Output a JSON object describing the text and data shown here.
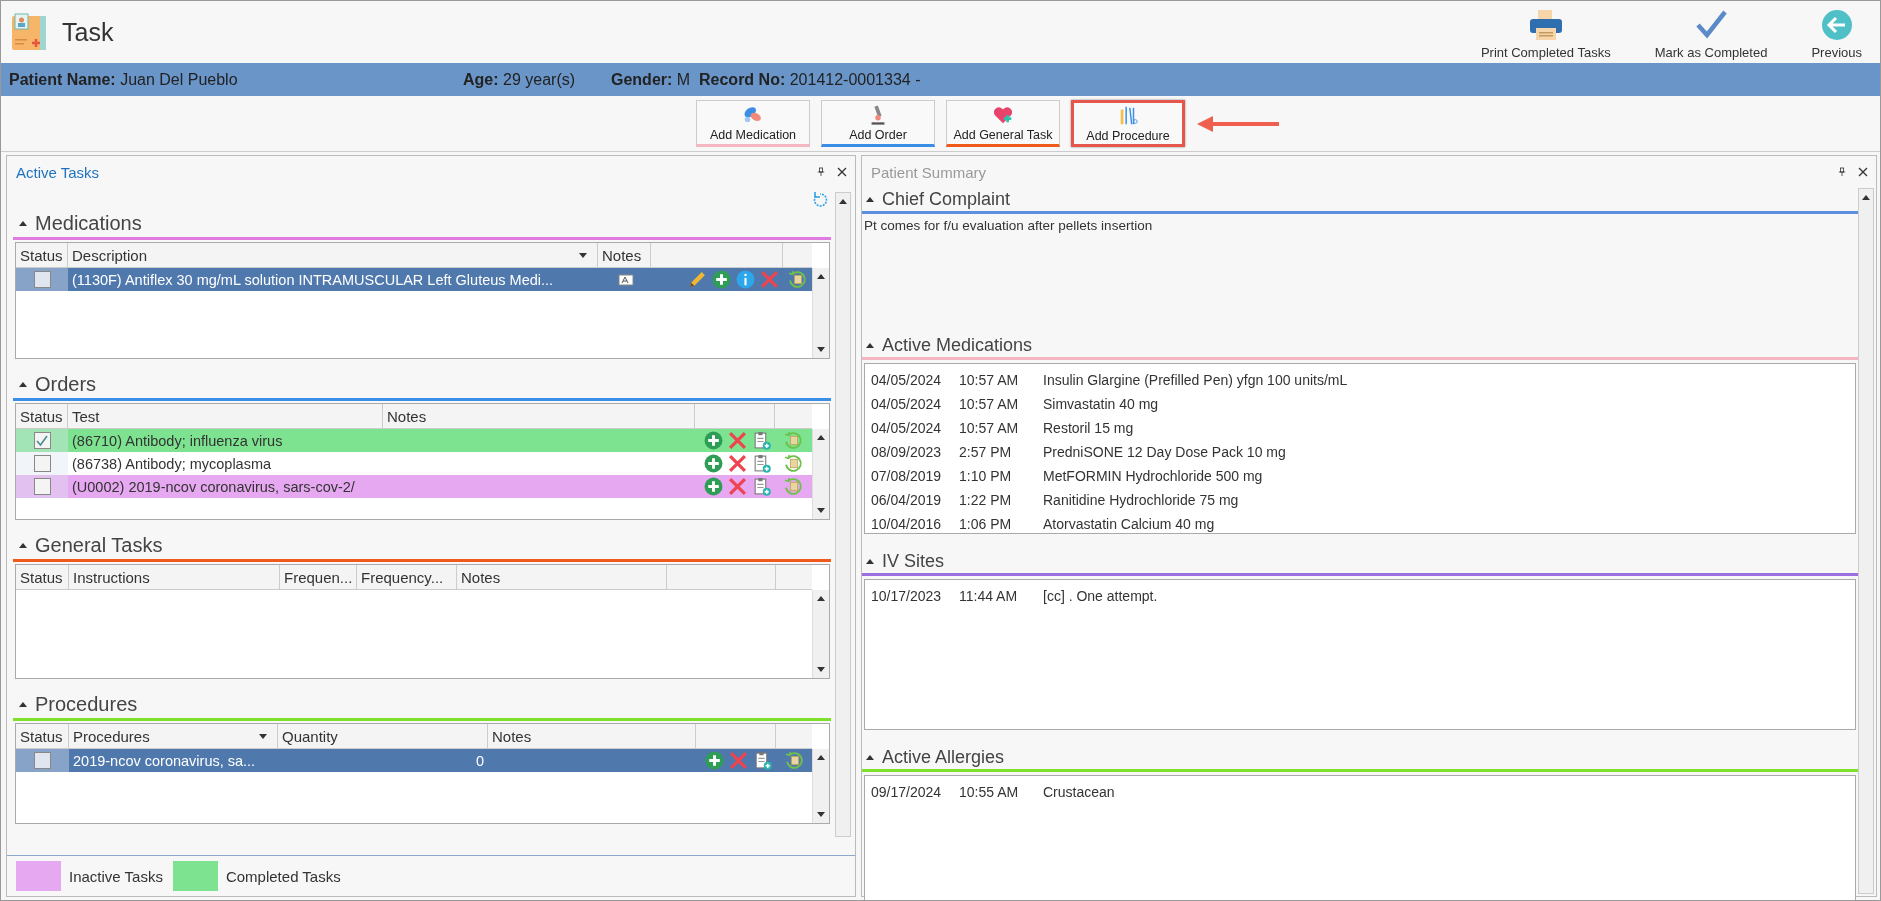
{
  "window": {
    "title": "Task"
  },
  "toolbar_actions": [
    {
      "label": "Print Completed Tasks",
      "kind": "print"
    },
    {
      "label": "Mark as Completed",
      "kind": "complete"
    },
    {
      "label": "Previous",
      "kind": "previous"
    }
  ],
  "patient": [
    {
      "label": "Patient Name:",
      "value": "Juan Del Pueblo"
    },
    {
      "label": "Age:",
      "value": "29 year(s)"
    },
    {
      "label": "Gender:",
      "value": "M"
    },
    {
      "label": "Record No:",
      "value": "201412-0001334 -"
    }
  ],
  "add_buttons": [
    {
      "label": "Add Medication",
      "kind": "medication",
      "color": "#f4b6c2",
      "highlighted": false
    },
    {
      "label": "Add Order",
      "kind": "order",
      "color": "#3a8ee6",
      "highlighted": false
    },
    {
      "label": "Add General Task",
      "kind": "general",
      "color": "#f05a1a",
      "highlighted": false
    },
    {
      "label": "Add Procedure",
      "kind": "procedure",
      "highlighted": true
    }
  ],
  "active_tasks": {
    "title": "Active Tasks",
    "sections": [
      {
        "title": "Medications",
        "kind": "medications",
        "color": "#e07be0",
        "columns": [
          {
            "label": "Status"
          },
          {
            "label": "Description",
            "menu": true
          },
          {
            "label": "Notes"
          }
        ],
        "rows": [
          {
            "checked": false,
            "selected": true,
            "completed": false,
            "inactive": false,
            "cells": [
              "",
              "(1130F) Antiflex 30 mg/mL solution INTRAMUSCULAR Left Gluteus Medi..."
            ],
            "note": true,
            "actions": [
              {
                "kind": "edit"
              },
              {
                "kind": "add"
              },
              {
                "kind": "info"
              },
              {
                "kind": "delete"
              }
            ]
          }
        ]
      },
      {
        "title": "Orders",
        "kind": "orders",
        "color": "#3a8ee6",
        "columns": [
          {
            "label": "Status"
          },
          {
            "label": "Test"
          },
          {
            "label": "Notes"
          }
        ],
        "rows": [
          {
            "checked": true,
            "selected": false,
            "completed": true,
            "inactive": false,
            "cells": [
              "",
              "(86710) Antibody; influenza virus"
            ],
            "note": false,
            "actions": [
              {
                "kind": "add"
              },
              {
                "kind": "delete"
              },
              {
                "kind": "clipboard"
              }
            ]
          },
          {
            "checked": false,
            "selected": false,
            "completed": false,
            "inactive": false,
            "cells": [
              "",
              "(86738) Antibody; mycoplasma"
            ],
            "note": false,
            "actions": [
              {
                "kind": "add"
              },
              {
                "kind": "delete"
              },
              {
                "kind": "clipboard"
              }
            ]
          },
          {
            "checked": false,
            "selected": false,
            "completed": false,
            "inactive": true,
            "cells": [
              "",
              "(U0002) 2019-ncov coronavirus, sars-cov-2/"
            ],
            "note": false,
            "actions": [
              {
                "kind": "add"
              },
              {
                "kind": "delete"
              },
              {
                "kind": "clipboard"
              }
            ]
          }
        ]
      },
      {
        "title": "General Tasks",
        "kind": "general",
        "color": "#f05a1a",
        "columns": [
          {
            "label": "Status"
          },
          {
            "label": "Instructions"
          },
          {
            "label": "Frequen..."
          },
          {
            "label": "Frequency..."
          },
          {
            "label": "Notes"
          }
        ]
      },
      {
        "title": "Procedures",
        "kind": "procedures",
        "color": "#7ee02a",
        "columns": [
          {
            "label": "Status"
          },
          {
            "label": "Procedures",
            "menu": true
          },
          {
            "label": "Quantity",
            "numeric": true
          },
          {
            "label": "Notes"
          }
        ],
        "rows": [
          {
            "checked": false,
            "selected": true,
            "completed": false,
            "inactive": false,
            "cells": [
              "",
              "2019-ncov coronavirus, sa...",
              "0"
            ],
            "note": false,
            "actions": [
              {
                "kind": "add"
              },
              {
                "kind": "delete"
              },
              {
                "kind": "clipboard"
              }
            ]
          }
        ]
      }
    ],
    "legend": [
      {
        "label": "Inactive Tasks",
        "color": "#e6a8f0"
      },
      {
        "label": "Completed Tasks",
        "color": "#7de390"
      }
    ]
  },
  "patient_summary": {
    "title": "Patient Summary",
    "sections": [
      {
        "title": "Chief Complaint",
        "kind": "text",
        "color": "#5b8fe0",
        "text": "Pt comes for f/u evaluation after pellets insertion"
      },
      {
        "title": "Active Medications",
        "kind": "list",
        "color": "#f4b6c2",
        "items": [
          {
            "date": "04/05/2024",
            "time": "10:57 AM",
            "description": "Insulin Glargine (Prefilled Pen) yfgn 100 units/mL"
          },
          {
            "date": "04/05/2024",
            "time": "10:57 AM",
            "description": "Simvastatin 40 mg"
          },
          {
            "date": "04/05/2024",
            "time": "10:57 AM",
            "description": "Restoril 15 mg"
          },
          {
            "date": "08/09/2023",
            "time": "2:57 PM",
            "description": "PredniSONE 12 Day Dose Pack 10 mg"
          },
          {
            "date": "07/08/2019",
            "time": "1:10 PM",
            "description": "MetFORMIN Hydrochloride 500 mg"
          },
          {
            "date": "06/04/2019",
            "time": "1:22 PM",
            "description": "Ranitidine Hydrochloride 75 mg"
          },
          {
            "date": "10/04/2016",
            "time": "1:06 PM",
            "description": "Atorvastatin Calcium 40 mg"
          }
        ]
      },
      {
        "title": "IV Sites",
        "kind": "list",
        "color": "#9b6fe0",
        "items": [
          {
            "date": "10/17/2023",
            "time": "11:44 AM",
            "description": "[cc] . One attempt."
          }
        ]
      },
      {
        "title": "Active Allergies",
        "kind": "list",
        "color": "#7ee02a",
        "items": [
          {
            "date": "09/17/2024",
            "time": "10:55 AM",
            "description": "Crustacean"
          }
        ]
      }
    ]
  }
}
